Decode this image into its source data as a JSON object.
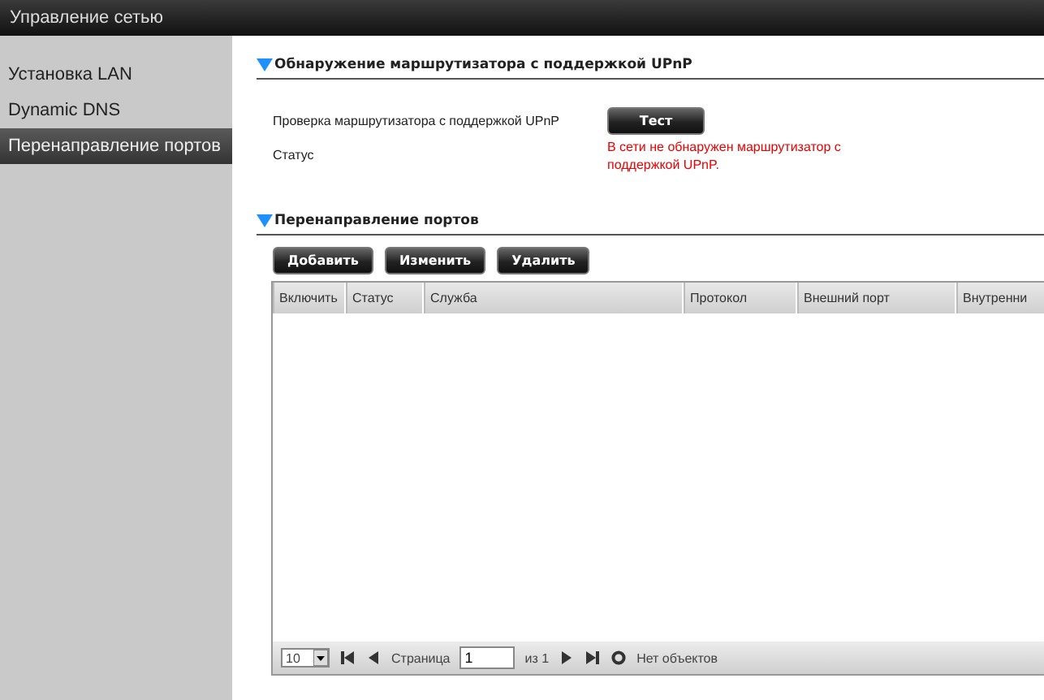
{
  "window": {
    "title": "Управление сетью"
  },
  "sidebar": {
    "items": [
      {
        "label": "Установка LAN",
        "selected": false
      },
      {
        "label": "Dynamic DNS",
        "selected": false
      },
      {
        "label": "Перенаправление портов",
        "selected": true
      }
    ]
  },
  "upnp_section": {
    "title": "Обнаружение маршрутизатора с поддержкой UPnP",
    "expanded": true,
    "check_label": "Проверка маршрутизатора с поддержкой UPnP",
    "test_button": "Тест",
    "status_label": "Статус",
    "status_message": "В сети не обнаружен маршрутизатор с поддержкой UPnP."
  },
  "port_forwarding": {
    "title": "Перенаправление портов",
    "expanded": true,
    "buttons": [
      "Добавить",
      "Изменить",
      "Удалить"
    ],
    "table": {
      "columns": [
        "Включить",
        "Статус",
        "Служба",
        "Протокол",
        "Внешний порт",
        "Внутренни"
      ]
    },
    "pager": {
      "page_size": "10",
      "page_label": "Страница",
      "page": "1",
      "of_label": "из 1",
      "status": "Нет объектов"
    }
  }
}
